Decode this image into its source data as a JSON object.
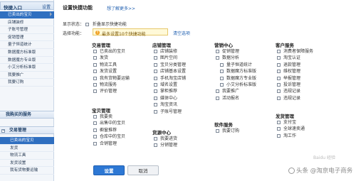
{
  "sidebar": {
    "title": "快捷入口",
    "settings_label": "设置",
    "items": [
      "已卖出的宝贝",
      "店铺装修",
      "子账号管理",
      "促销管理",
      "量子恒道统计",
      "数据魔方标准版",
      "数据魔方专业版",
      "小艾分析标准版",
      "我要推广",
      "我要订购"
    ],
    "section1": "我购买的服务",
    "section2": "交易管理",
    "items2": [
      "已卖出的宝贝",
      "发货",
      "物流工具",
      "发货设置",
      "我有货物要运输"
    ]
  },
  "main": {
    "title": "设置快捷功能",
    "help_link": "想了解更多>>",
    "display_status_label": "显示状态：",
    "display_status_option": "折叠显示快捷功能",
    "selected_label": "选择功能：",
    "hint_text": "最多设置10个快捷功能",
    "clear_link": "清空选项",
    "groups": [
      {
        "title": "交易管理",
        "options": [
          "已卖出的宝贝",
          "发货",
          "物流工具",
          "发货设置",
          "我有货物要运输",
          "物流服务",
          "评价管理"
        ]
      },
      {
        "title": "宝贝管理",
        "options": [
          "我要卖",
          "出售中的宝贝",
          "橱窗推荐",
          "仓库中的宝贝",
          "合销管理"
        ]
      },
      {
        "title": "店铺管理",
        "options": [
          "店铺装修",
          "图片空间",
          "宝贝分类管理",
          "店铺基本设置",
          "手机淘宝店铺",
          "域名设置",
          "掌柜推荐",
          "媒体中心",
          "淘宝资讯",
          "子账号管理"
        ]
      },
      {
        "title": "营销中心",
        "options": [
          "促销管理",
          "数据分析",
          "量子恒道统计",
          "数据魔方标准版",
          "数据魔方专业版",
          "小艾分析标准版",
          "我要推广",
          "活动报名"
        ]
      },
      {
        "title": "客户服务",
        "options": [
          "消费者保障服务",
          "淘宝认证",
          "退款管理",
          "维权管理",
          "举报管理",
          "投诉管理",
          "违规记录",
          "违规记录"
        ]
      },
      {
        "title": "货源中心",
        "options": [
          "我要进货",
          "分销管理"
        ]
      },
      {
        "title": "软件服务",
        "options": [
          "我要订购"
        ]
      },
      {
        "title": "发货管理",
        "options": [
          "支付宝",
          "全球速卖通",
          "淘工作"
        ]
      }
    ],
    "save_label": "设置",
    "cancel_label": "取消"
  },
  "watermark": {
    "text": "头条 @淘京电子商务",
    "sub": "Baidu 经验"
  }
}
